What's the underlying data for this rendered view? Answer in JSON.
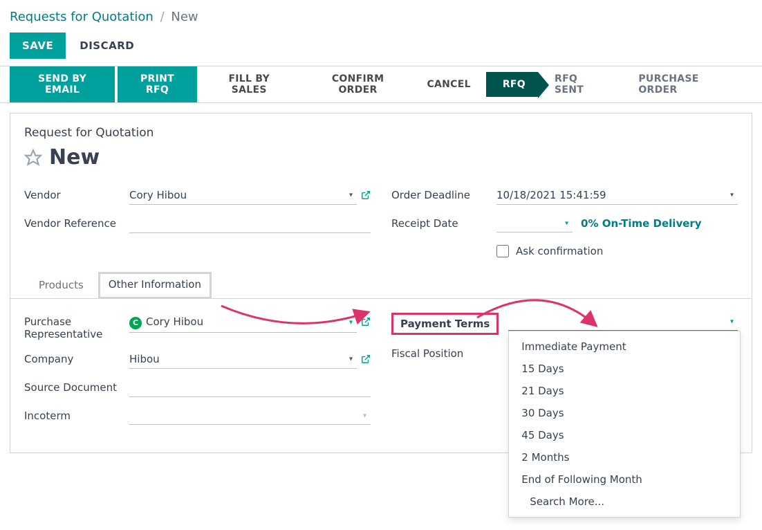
{
  "breadcrumb": {
    "parent": "Requests for Quotation",
    "current": "New"
  },
  "header": {
    "save": "SAVE",
    "discard": "DISCARD"
  },
  "actions": {
    "send_email": "SEND BY EMAIL",
    "print_rfq": "PRINT RFQ",
    "fill_by_sales": "FILL BY SALES",
    "confirm_order": "CONFIRM ORDER",
    "cancel": "CANCEL"
  },
  "status": {
    "rfq": "RFQ",
    "rfq_sent": "RFQ SENT",
    "purchase_order": "PURCHASE ORDER"
  },
  "form": {
    "title_small": "Request for Quotation",
    "title_big": "New",
    "vendor_label": "Vendor",
    "vendor_value": "Cory Hibou",
    "vendor_ref_label": "Vendor Reference",
    "order_deadline_label": "Order Deadline",
    "order_deadline_value": "10/18/2021 15:41:59",
    "receipt_date_label": "Receipt Date",
    "ontime_text": "0% On-Time Delivery",
    "ask_confirmation_label": "Ask confirmation"
  },
  "tabs": {
    "products": "Products",
    "other_info": "Other Information"
  },
  "other_info": {
    "purchase_rep_label": "Purchase Representative",
    "purchase_rep_value": "Cory Hibou",
    "company_label": "Company",
    "company_value": "Hibou",
    "source_doc_label": "Source Document",
    "incoterm_label": "Incoterm",
    "payment_terms_label": "Payment Terms",
    "fiscal_position_label": "Fiscal Position"
  },
  "payment_terms_options": [
    "Immediate Payment",
    "15 Days",
    "21 Days",
    "30 Days",
    "45 Days",
    "2 Months",
    "End of Following Month"
  ],
  "search_more": "Search More..."
}
